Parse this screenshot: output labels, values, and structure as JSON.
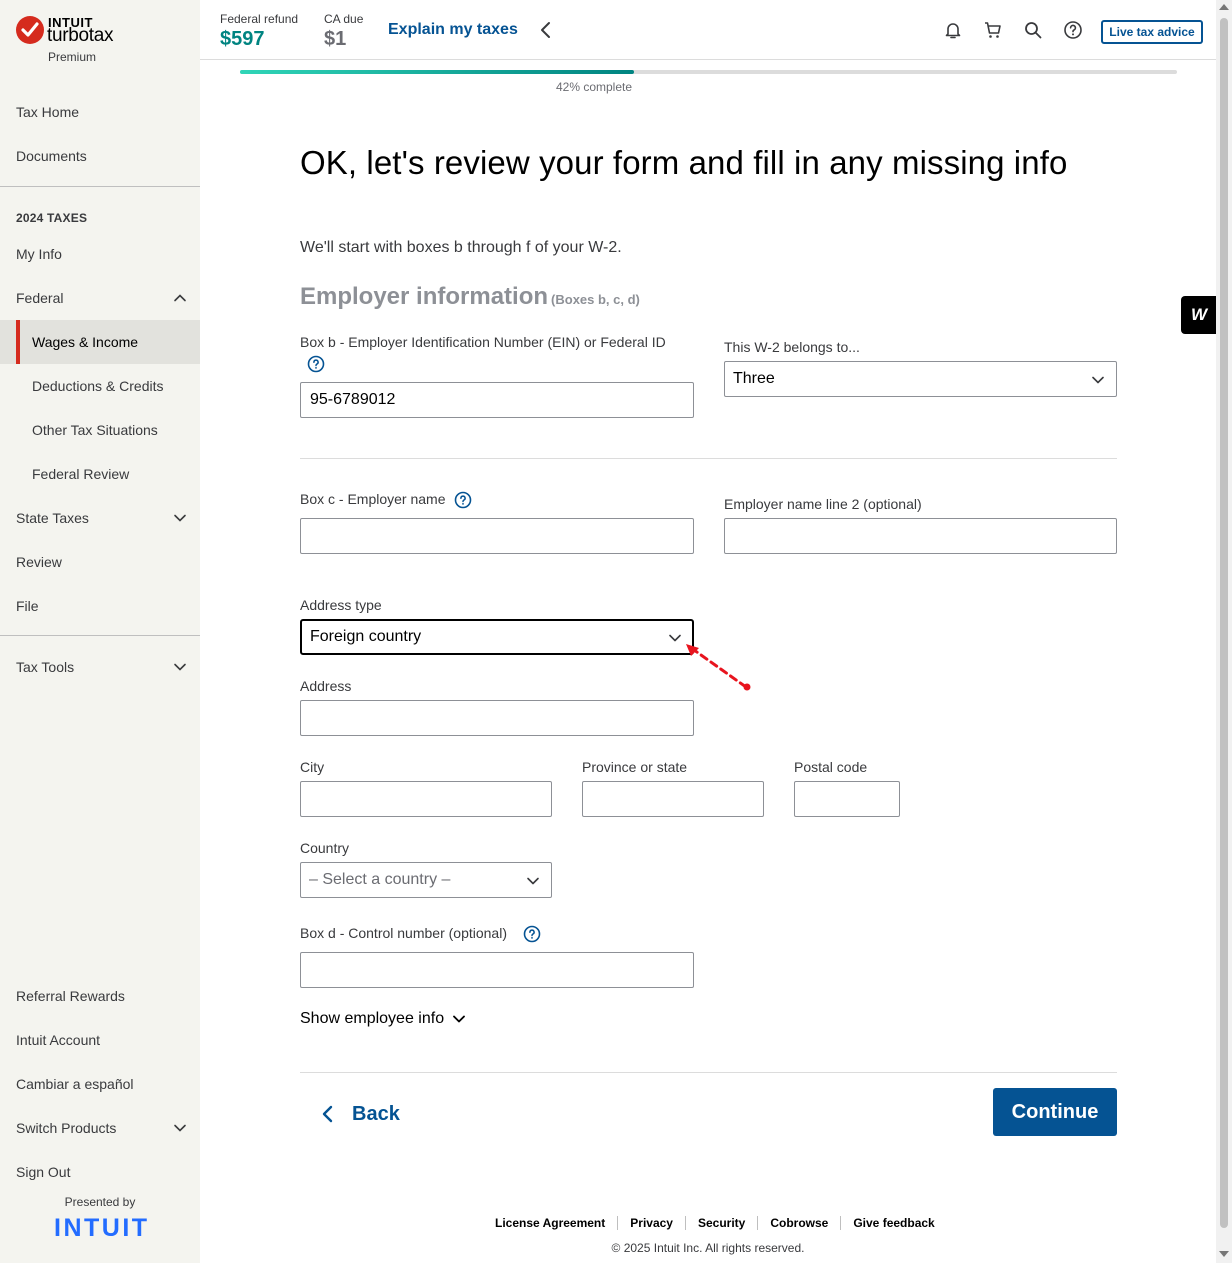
{
  "brand": {
    "company": "INTUIT",
    "product": "turbotax",
    "tier": "Premium",
    "presented_by": "Presented by",
    "footer_brand": "INTUIT"
  },
  "sidebar": {
    "items_top": [
      {
        "label": "Tax Home"
      },
      {
        "label": "Documents"
      }
    ],
    "section_label": "2024 TAXES",
    "my_info": "My Info",
    "federal": "Federal",
    "federal_sub": [
      {
        "label": "Wages & Income",
        "active": true
      },
      {
        "label": "Deductions & Credits"
      },
      {
        "label": "Other Tax Situations"
      },
      {
        "label": "Federal Review"
      }
    ],
    "state_taxes": "State Taxes",
    "review": "Review",
    "file": "File",
    "tax_tools": "Tax Tools",
    "bottom": {
      "referral": "Referral Rewards",
      "account": "Intuit Account",
      "language": "Cambiar a español",
      "switch_products": "Switch Products",
      "sign_out": "Sign Out"
    }
  },
  "header": {
    "federal_refund_label": "Federal refund",
    "federal_refund_value": "$597",
    "ca_due_label": "CA due",
    "ca_due_value": "$1",
    "explain_link": "Explain my taxes",
    "live_advice": "Live tax advice",
    "icons": [
      "bell-icon",
      "cart-icon",
      "search-icon",
      "help-icon"
    ]
  },
  "progress": {
    "percent": 42,
    "text": "42% complete"
  },
  "main": {
    "title": "OK, let's review your form and fill in any missing info",
    "intro": "We'll start with boxes b through f of your W-2.",
    "section_title": "Employer information",
    "section_sub": "(Boxes b, c, d)",
    "ein": {
      "label": "Box b - Employer Identification Number (EIN) or Federal ID",
      "value": "95-6789012"
    },
    "belongs_to": {
      "label": "This W-2 belongs to...",
      "value": "Three"
    },
    "employer_name": {
      "label": "Box c - Employer name",
      "value": ""
    },
    "employer_name2": {
      "label": "Employer name line 2 (optional)",
      "value": ""
    },
    "address_type": {
      "label": "Address type",
      "value": "Foreign country"
    },
    "address": {
      "label": "Address",
      "value": ""
    },
    "city": {
      "label": "City",
      "value": ""
    },
    "province": {
      "label": "Province or state",
      "value": ""
    },
    "postal": {
      "label": "Postal code",
      "value": ""
    },
    "country": {
      "label": "Country",
      "placeholder": "– Select a country –"
    },
    "control_number": {
      "label": "Box d - Control number (optional)",
      "value": ""
    },
    "show_employee": "Show employee info",
    "back": "Back",
    "continue": "Continue"
  },
  "footer": {
    "links": [
      "License Agreement",
      "Privacy",
      "Security",
      "Cobrowse",
      "Give feedback"
    ],
    "copyright": "© 2025 Intuit Inc. All rights reserved."
  },
  "widget": {
    "label": "W"
  },
  "colors": {
    "accent": "#055393",
    "refund": "#008481",
    "brand_red": "#d52b1e",
    "intuit_blue": "#236cff"
  }
}
